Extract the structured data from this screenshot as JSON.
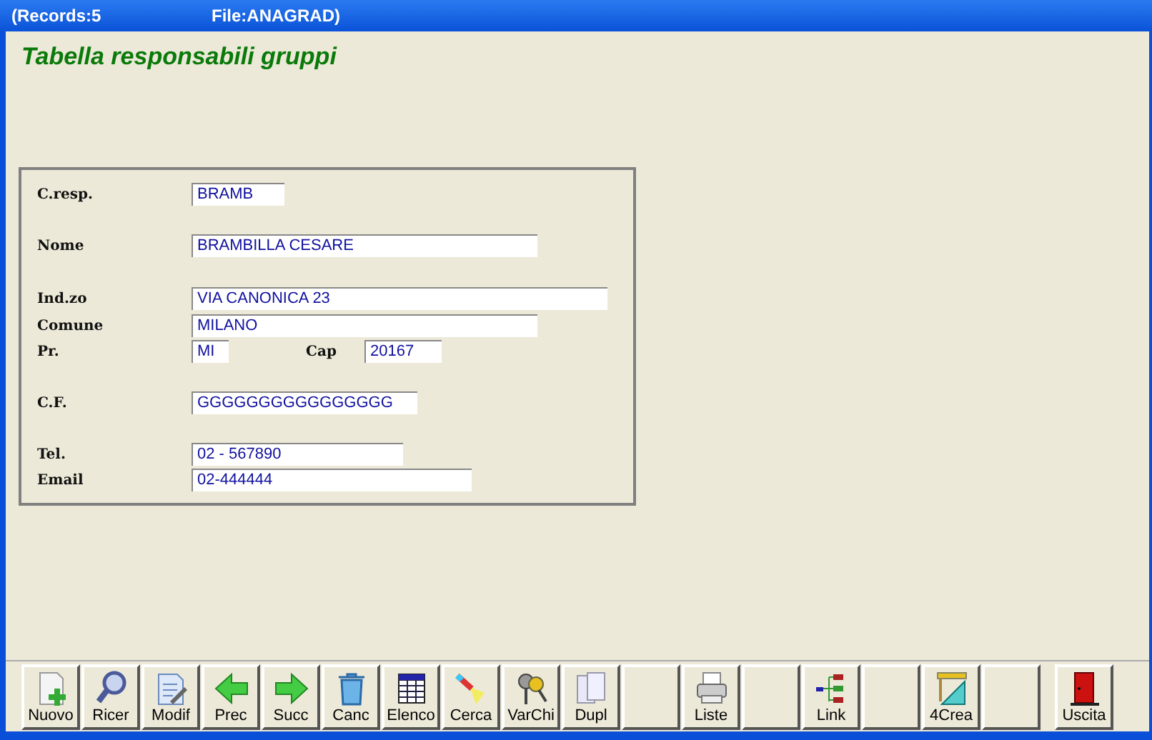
{
  "window": {
    "title_parts": [
      "(Records:5",
      "File:ANAGRAD)"
    ]
  },
  "heading": "Tabella responsabili gruppi",
  "form_rows": [
    {
      "fields": [
        {
          "label": "C.resp.",
          "value": "BRAMB"
        }
      ]
    },
    {
      "fields": [
        {
          "label": "Nome",
          "value": "BRAMBILLA CESARE"
        }
      ]
    },
    {
      "fields": [
        {
          "label": "Ind.zo",
          "value": "VIA CANONICA 23"
        }
      ]
    },
    {
      "fields": [
        {
          "label": "Comune",
          "value": "MILANO"
        }
      ]
    },
    {
      "fields": [
        {
          "label": "Pr.",
          "value": "MI"
        },
        {
          "label": "Cap",
          "value": "20167"
        }
      ]
    },
    {
      "fields": [
        {
          "label": "C.F.",
          "value": "GGGGGGGGGGGGGGGG"
        }
      ]
    },
    {
      "fields": [
        {
          "label": "Tel.",
          "value": "02 - 567890"
        }
      ]
    },
    {
      "fields": [
        {
          "label": "Email",
          "value": "02-444444"
        }
      ]
    }
  ],
  "toolbar": [
    {
      "kind": "button",
      "label": "Nuovo"
    },
    {
      "kind": "button",
      "label": "Ricer"
    },
    {
      "kind": "button",
      "label": "Modif"
    },
    {
      "kind": "button",
      "label": "Prec"
    },
    {
      "kind": "button",
      "label": "Succ"
    },
    {
      "kind": "button",
      "label": "Canc"
    },
    {
      "kind": "button",
      "label": "Elenco"
    },
    {
      "kind": "button",
      "label": "Cerca"
    },
    {
      "kind": "button",
      "label": "VarChi"
    },
    {
      "kind": "button",
      "label": "Dupl"
    },
    {
      "kind": "empty"
    },
    {
      "kind": "button",
      "label": "Liste"
    },
    {
      "kind": "empty"
    },
    {
      "kind": "button",
      "label": "Link"
    },
    {
      "kind": "empty"
    },
    {
      "kind": "button",
      "label": "4Crea"
    },
    {
      "kind": "empty"
    },
    {
      "kind": "button",
      "label": "Uscita"
    }
  ]
}
